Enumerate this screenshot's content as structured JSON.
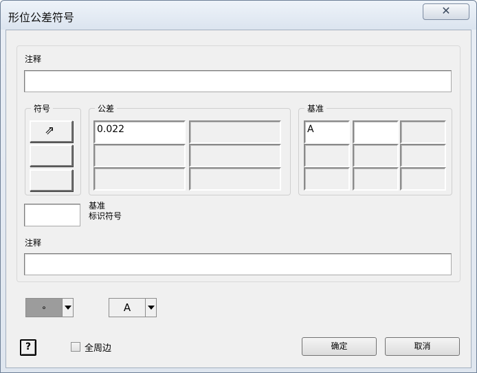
{
  "window": {
    "title": "形位公差符号",
    "close_glyph": "✕"
  },
  "note_top": {
    "label": "注释",
    "value": ""
  },
  "symbol_group": {
    "title": "符号",
    "button_glyph": "⇗"
  },
  "tolerance_group": {
    "title": "公差",
    "cells": [
      [
        "0.022",
        ""
      ],
      [
        "",
        ""
      ],
      [
        "",
        ""
      ]
    ]
  },
  "datum_group": {
    "title": "基准",
    "cells": [
      [
        "A",
        "",
        ""
      ],
      [
        "",
        "",
        ""
      ],
      [
        "",
        "",
        ""
      ]
    ]
  },
  "datum_id": {
    "line1": "基准",
    "line2": "标识符号",
    "value": ""
  },
  "note_bottom": {
    "label": "注释",
    "value": ""
  },
  "dropdowns": {
    "leader": "∘",
    "text_style": "A"
  },
  "help_glyph": "?",
  "all_around": {
    "label": "全周边",
    "checked": false
  },
  "buttons": {
    "ok": "确定",
    "cancel": "取消"
  },
  "colors": {
    "dropdown_grey": "#9c9c9c",
    "window_frame": "#6d7f96"
  }
}
